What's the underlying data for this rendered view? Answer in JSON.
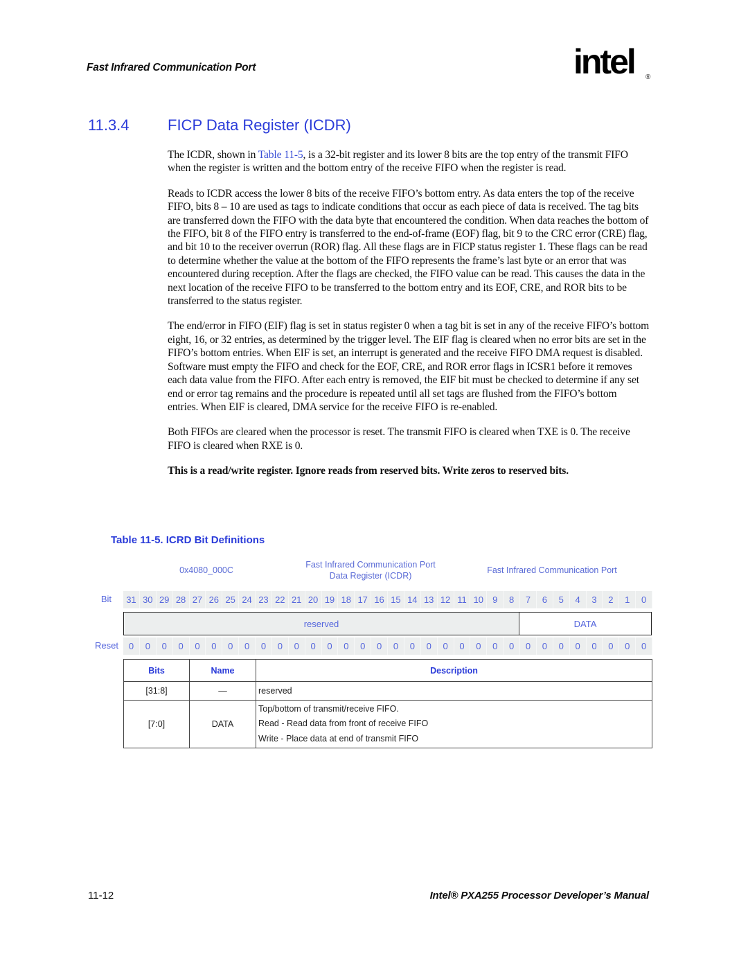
{
  "header": {
    "running_title": "Fast Infrared Communication Port",
    "logo_text": "intel",
    "logo_mark": "®"
  },
  "section": {
    "number": "11.3.4",
    "title": "FICP Data Register (ICDR)"
  },
  "body": {
    "p1_before_link": "The ICDR, shown in ",
    "p1_link": "Table 11-5",
    "p1_after_link": ", is a 32-bit register and its lower 8 bits are the top entry of the transmit FIFO when the register is written and the bottom entry of the receive FIFO when the register is read.",
    "p2": "Reads to ICDR access the lower 8 bits of the receive FIFO’s bottom entry. As data enters the top of the receive FIFO, bits 8 – 10 are used as tags to indicate conditions that occur as each piece of data is received. The tag bits are transferred down the FIFO with the data byte that encountered the condition. When data reaches the bottom of the FIFO, bit 8 of the FIFO entry is transferred to the end-of-frame (EOF) flag, bit 9 to the CRC error (CRE) flag, and bit 10 to the receiver overrun (ROR) flag. All these flags are in FICP status register 1. These flags can be read to determine whether the value at the bottom of the FIFO represents the frame’s last byte or an error that was encountered during reception. After the flags are checked, the FIFO value can be read. This causes the data in the next location of the receive FIFO to be transferred to the bottom entry and its EOF, CRE, and ROR bits to be transferred to the status register.",
    "p3": "The end/error in FIFO (EIF) flag is set in status register 0 when a tag bit is set in any of the receive FIFO’s bottom eight, 16, or 32 entries, as determined by the trigger level. The EIF flag is cleared when no error bits are set in the FIFO’s bottom entries. When EIF is set, an interrupt is generated and the receive FIFO DMA request is disabled. Software must empty the FIFO and check for the EOF, CRE, and ROR error flags in ICSR1 before it removes each data value from the FIFO. After each entry is removed, the EIF bit must be checked to determine if any set end or error tag remains and the procedure is repeated until all set tags are flushed from the FIFO’s bottom entries. When EIF is cleared, DMA service for the receive FIFO is re-enabled.",
    "p4": "Both FIFOs are cleared when the processor is reset. The transmit FIFO is cleared when TXE is 0. The receive FIFO is cleared when RXE is 0.",
    "note": "This is a read/write register. Ignore reads from reserved bits. Write zeros to reserved bits."
  },
  "table": {
    "caption": "Table 11-5. ICRD Bit Definitions",
    "address": "0x4080_000C",
    "register_name_line1": "Fast Infrared Communication Port",
    "register_name_line2": "Data Register (ICDR)",
    "unit_name": "Fast Infrared Communication Port",
    "bit_label": "Bit",
    "reset_label": "Reset",
    "bits": [
      "31",
      "30",
      "29",
      "28",
      "27",
      "26",
      "25",
      "24",
      "23",
      "22",
      "21",
      "20",
      "19",
      "18",
      "17",
      "16",
      "15",
      "14",
      "13",
      "12",
      "11",
      "10",
      "9",
      "8",
      "7",
      "6",
      "5",
      "4",
      "3",
      "2",
      "1",
      "0"
    ],
    "reset_values": [
      "0",
      "0",
      "0",
      "0",
      "0",
      "0",
      "0",
      "0",
      "0",
      "0",
      "0",
      "0",
      "0",
      "0",
      "0",
      "0",
      "0",
      "0",
      "0",
      "0",
      "0",
      "0",
      "0",
      "0",
      "0",
      "0",
      "0",
      "0",
      "0",
      "0",
      "0",
      "0"
    ],
    "fields": [
      {
        "name": "reserved",
        "width_bits": 24
      },
      {
        "name": "DATA",
        "width_bits": 8
      }
    ],
    "columns": [
      "Bits",
      "Name",
      "Description"
    ],
    "rows": [
      {
        "bits": "[31:8]",
        "name": "—",
        "description": [
          "reserved"
        ]
      },
      {
        "bits": "[7:0]",
        "name": "DATA",
        "description": [
          "Top/bottom of transmit/receive FIFO.",
          "Read - Read data from front of receive FIFO",
          "Write - Place data at end of transmit FIFO"
        ]
      }
    ]
  },
  "footer": {
    "page_number": "11-12",
    "manual_title": "Intel® PXA255 Processor Developer’s Manual"
  }
}
